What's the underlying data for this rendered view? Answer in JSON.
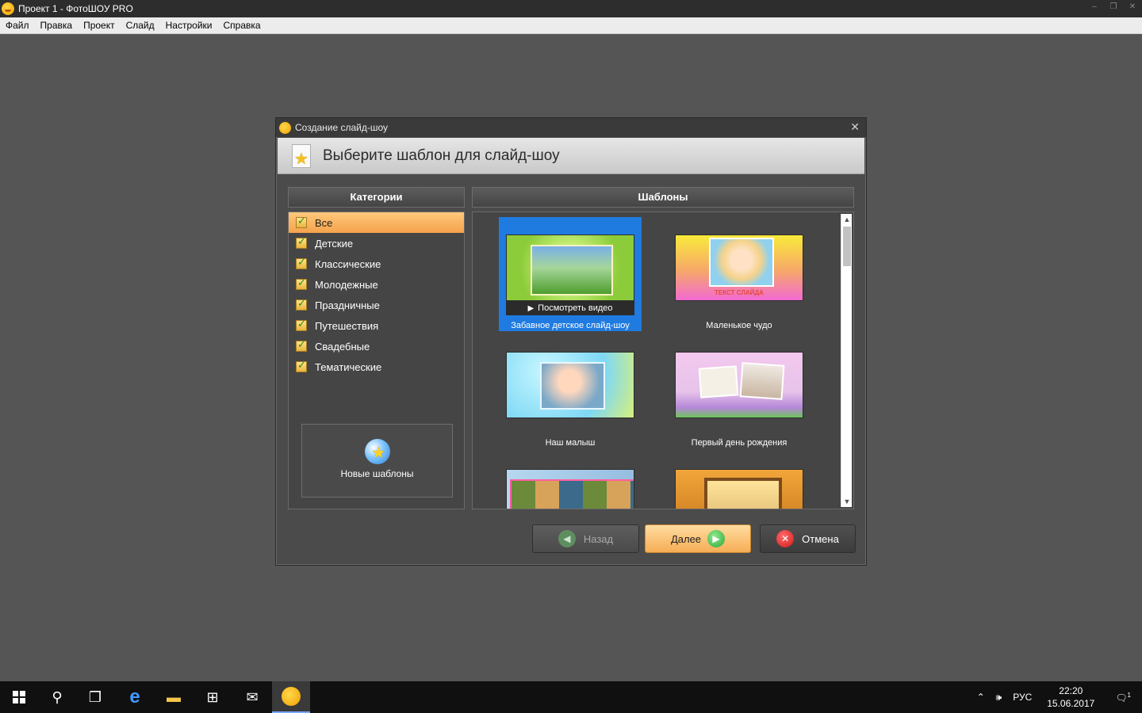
{
  "window": {
    "title": "Проект 1 - ФотоШОУ PRO",
    "controls": [
      "–",
      "❐",
      "✕"
    ]
  },
  "menu": [
    "Файл",
    "Правка",
    "Проект",
    "Слайд",
    "Настройки",
    "Справка"
  ],
  "dialog": {
    "title": "Создание слайд-шоу",
    "close": "✕",
    "header_title": "Выберите шаблон для слайд-шоу",
    "categories_header": "Категории",
    "templates_header": "Шаблоны",
    "categories": [
      {
        "label": "Все",
        "selected": true
      },
      {
        "label": "Детские",
        "selected": false
      },
      {
        "label": "Классические",
        "selected": false
      },
      {
        "label": "Молодежные",
        "selected": false
      },
      {
        "label": "Праздничные",
        "selected": false
      },
      {
        "label": "Путешествия",
        "selected": false
      },
      {
        "label": "Свадебные",
        "selected": false
      },
      {
        "label": "Тематические",
        "selected": false
      }
    ],
    "new_templates": "Новые шаблоны",
    "templates": [
      {
        "label": "Забавное детское слайд-шоу",
        "selected": true
      },
      {
        "label": "Маленькое чудо",
        "selected": false
      },
      {
        "label": "Наш малыш",
        "selected": false
      },
      {
        "label": "Первый день рождения",
        "selected": false
      },
      {
        "label": "",
        "selected": false
      },
      {
        "label": "",
        "selected": false
      }
    ],
    "watch_video": "Посмотреть видео",
    "buttons": {
      "back": "Назад",
      "next": "Далее",
      "cancel": "Отмена"
    }
  },
  "taskbar": {
    "language": "РУС",
    "time": "22:20",
    "date": "15.06.2017",
    "notification_count": "1"
  },
  "colors": {
    "accent_selected_category": "#f4a24b",
    "accent_selected_template": "#1f7be0"
  },
  "icons": [
    "app-icon",
    "doc-star-icon",
    "check-icon",
    "globe-star-icon",
    "play-icon",
    "back-arrow-icon",
    "next-arrow-icon",
    "cancel-x-icon",
    "windows-start-icon",
    "search-icon",
    "task-view-icon",
    "edge-icon",
    "file-explorer-icon",
    "store-icon",
    "mail-icon",
    "photoshow-icon",
    "chevron-up-icon",
    "volume-icon",
    "notification-icon"
  ]
}
